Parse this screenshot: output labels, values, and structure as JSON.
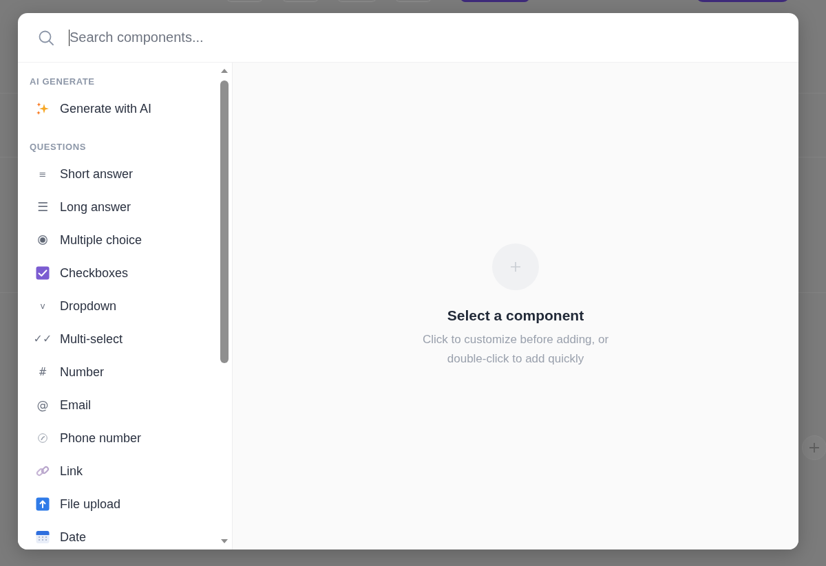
{
  "search": {
    "placeholder": "Search components..."
  },
  "sections": [
    {
      "title": "AI GENERATE",
      "items": [
        {
          "label": "Generate with AI",
          "kind": "sparkle"
        }
      ]
    },
    {
      "title": "QUESTIONS",
      "items": [
        {
          "label": "Short answer",
          "kind": "lines",
          "glyph": "≡"
        },
        {
          "label": "Long answer",
          "kind": "menu",
          "glyph": "☰"
        },
        {
          "label": "Multiple choice",
          "kind": "radio"
        },
        {
          "label": "Checkboxes",
          "kind": "checkbox"
        },
        {
          "label": "Dropdown",
          "kind": "chevron",
          "glyph": "v"
        },
        {
          "label": "Multi-select",
          "kind": "checks",
          "glyph": "✓✓"
        },
        {
          "label": "Number",
          "kind": "hash",
          "glyph": "#"
        },
        {
          "label": "Email",
          "kind": "at",
          "glyph": "@"
        },
        {
          "label": "Phone number",
          "kind": "phone"
        },
        {
          "label": "Link",
          "kind": "link"
        },
        {
          "label": "File upload",
          "kind": "upload"
        },
        {
          "label": "Date",
          "kind": "calendar"
        }
      ]
    }
  ],
  "empty_state": {
    "title": "Select a component",
    "hint": "Click to customize before adding, or double-click to add quickly"
  }
}
